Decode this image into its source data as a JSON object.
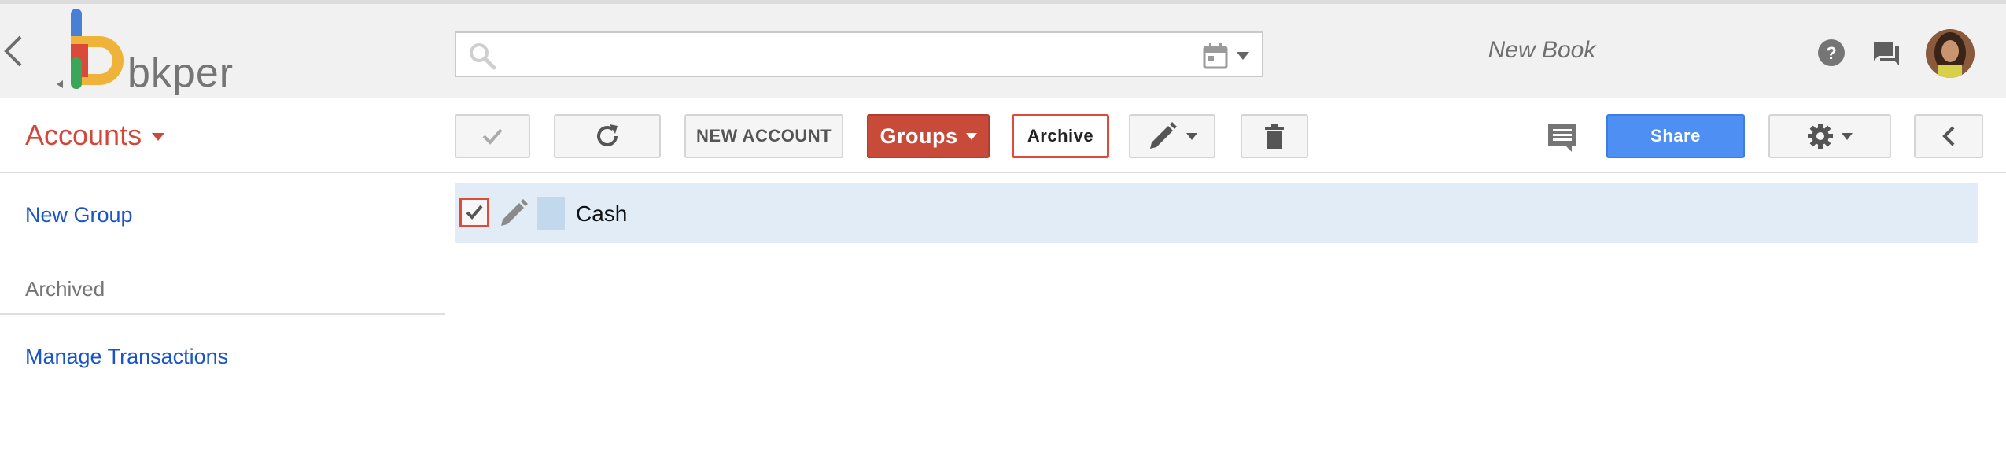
{
  "header": {
    "logo_text": "bkper",
    "search": {
      "value": "",
      "placeholder": ""
    },
    "book_name": "New Book",
    "icons": [
      "back-icon",
      "search-icon",
      "calendar-icon",
      "help-icon",
      "chat-icon",
      "avatar"
    ]
  },
  "toolbar": {
    "section_title": "Accounts",
    "new_account_label": "NEW ACCOUNT",
    "groups_label": "Groups",
    "archive_label": "Archive",
    "share_label": "Share"
  },
  "sidebar": {
    "new_group_label": "New Group",
    "archived_label": "Archived",
    "manage_transactions_label": "Manage Transactions"
  },
  "accounts": [
    {
      "name": "Cash",
      "selected": true,
      "color": "#c2d8ec"
    }
  ],
  "colors": {
    "accent_red": "#c84b3a",
    "share_blue": "#4d8ff2",
    "link_blue": "#1a55c7",
    "row_highlight": "#e1ecf6"
  }
}
